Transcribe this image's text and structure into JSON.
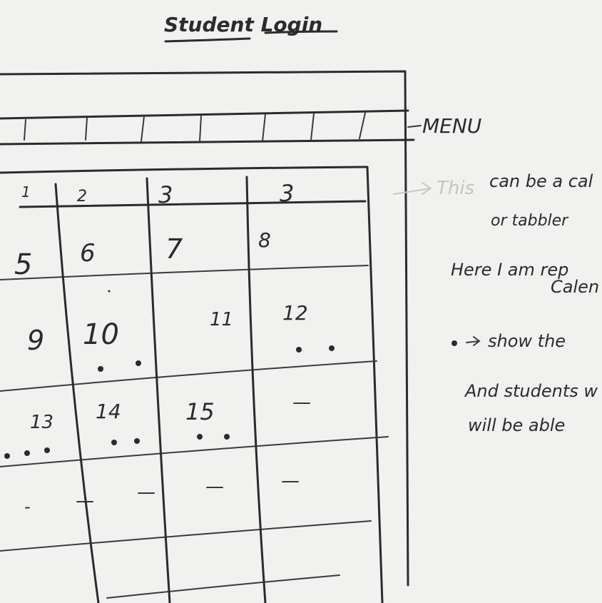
{
  "title": "Student Login",
  "menu_label": "MENU",
  "note": {
    "line1_faint": "This",
    "line1": "can be a cal",
    "line2": "or tabbler",
    "line3": "Here I am rep",
    "line4": "Calen",
    "line5": "show the",
    "line6": "And students w",
    "line7": "will be able"
  },
  "calendar": {
    "headers": [
      "1",
      "2",
      "3",
      "3"
    ],
    "row1": [
      "5",
      "6",
      "7",
      "8"
    ],
    "row2": [
      "9",
      "10",
      "11",
      "12"
    ],
    "row3": [
      "13",
      "14",
      "15",
      "—"
    ],
    "row4": [
      "-",
      "—",
      "—",
      "—",
      "—"
    ]
  }
}
